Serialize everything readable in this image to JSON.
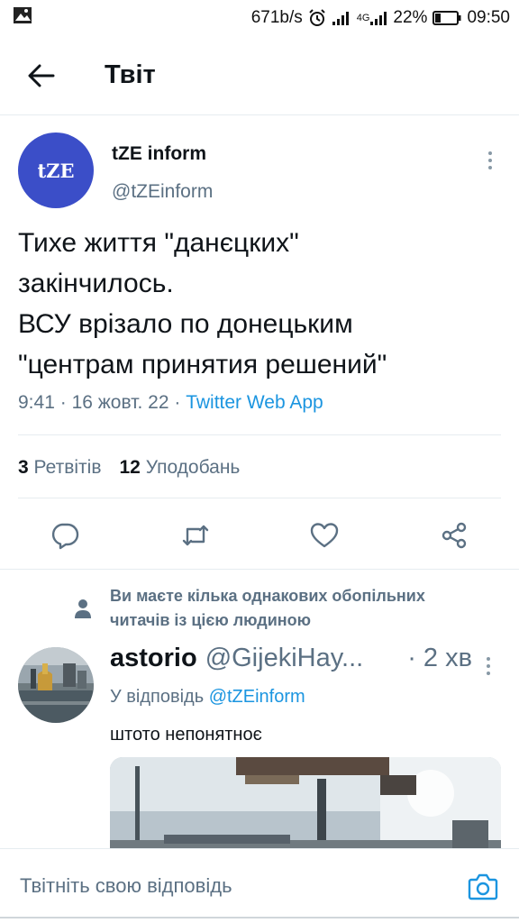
{
  "status_bar": {
    "speed": "671b/s",
    "network_label": "4G",
    "battery": "22%",
    "time": "09:50",
    "icons": [
      "image-icon",
      "alarm-icon",
      "signal-icon",
      "signal-4g-icon",
      "battery-icon"
    ]
  },
  "header": {
    "title": "Твіт",
    "back_icon": "arrow-left-icon"
  },
  "tweet": {
    "avatar_text": "tZE",
    "author_name": "tZE inform",
    "author_handle": "@tZEinform",
    "text_lines": [
      "Тихе життя \"данєцких\"",
      "закінчилось.",
      "ВСУ врізало по донецьким",
      "\"центрам принятия решений\""
    ],
    "time": "9:41",
    "separator": "·",
    "date": "16 жовт. 22",
    "app": "Twitter Web App",
    "retweets_count": "3",
    "retweets_label": "Ретвітів",
    "likes_count": "12",
    "likes_label": "Уподобань",
    "actions": [
      "reply-icon",
      "retweet-icon",
      "like-icon",
      "share-icon"
    ]
  },
  "notice": {
    "line1": "Ви маєте кілька однакових обопільних",
    "line2": "читачів із цією людиною",
    "icon": "person-icon"
  },
  "reply": {
    "name": "astorio",
    "handle": "@GijekiHay...",
    "time": "· 2 хв",
    "reply_prefix": "У відповідь",
    "reply_mention": "@tZEinform",
    "text": "штото непонятноє"
  },
  "composer": {
    "placeholder": "Твітніть свою відповідь",
    "icon": "camera-icon"
  },
  "colors": {
    "accent": "#1b95e0",
    "avatar_bg": "#3b4ec8",
    "muted": "#5b7083"
  }
}
